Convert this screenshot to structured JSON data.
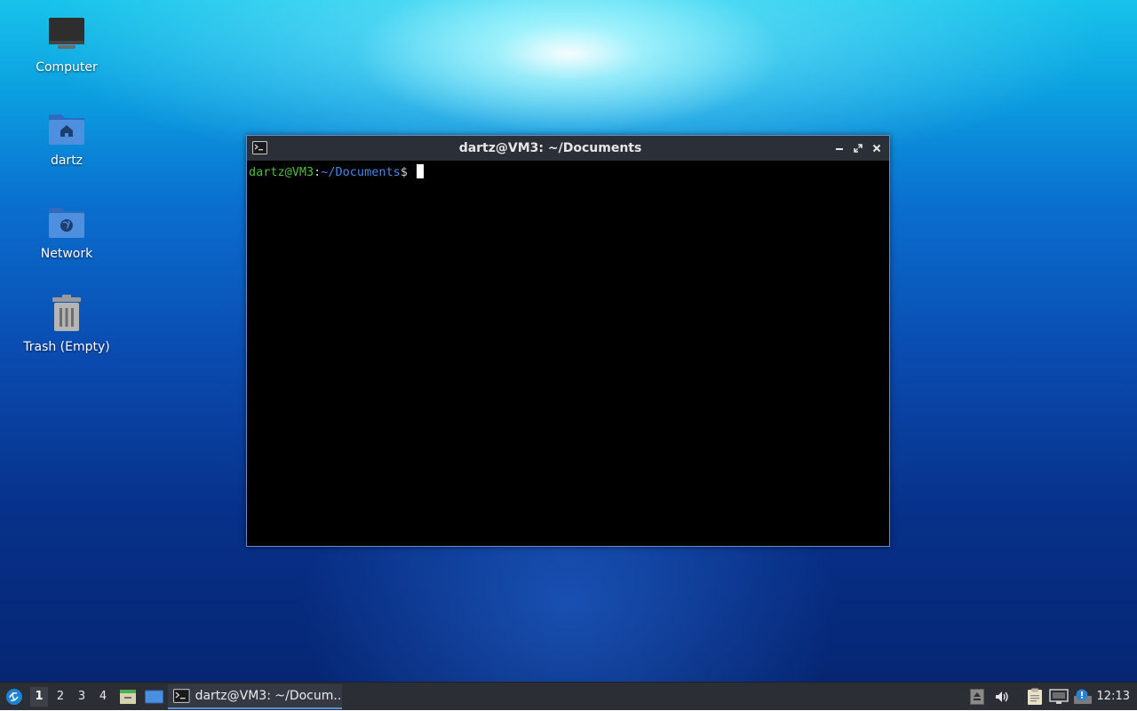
{
  "desktop": {
    "icons": [
      {
        "label": "Computer",
        "icon": "computer-icon"
      },
      {
        "label": "dartz",
        "icon": "home-folder-icon"
      },
      {
        "label": "Network",
        "icon": "network-folder-icon"
      },
      {
        "label": "Trash (Empty)",
        "icon": "trash-icon"
      }
    ]
  },
  "terminal": {
    "title": "dartz@VM3: ~/Documents",
    "prompt_user": "dartz@VM3",
    "prompt_colon": ":",
    "prompt_path": "~/Documents",
    "prompt_symbol": "$",
    "buttons": {
      "minimize": "minimize-icon",
      "maximize": "maximize-icon",
      "close": "close-icon"
    }
  },
  "taskbar": {
    "workspaces": [
      "1",
      "2",
      "3",
      "4"
    ],
    "active_workspace": "1",
    "task_label": "dartz@VM3: ~/Docum...",
    "clock": "12:13"
  },
  "colors": {
    "prompt_user": "#4ebd3e",
    "prompt_path": "#4a86e0",
    "taskbar_bg": "#2b2e35",
    "titlebar_bg": "#2b2f37"
  }
}
